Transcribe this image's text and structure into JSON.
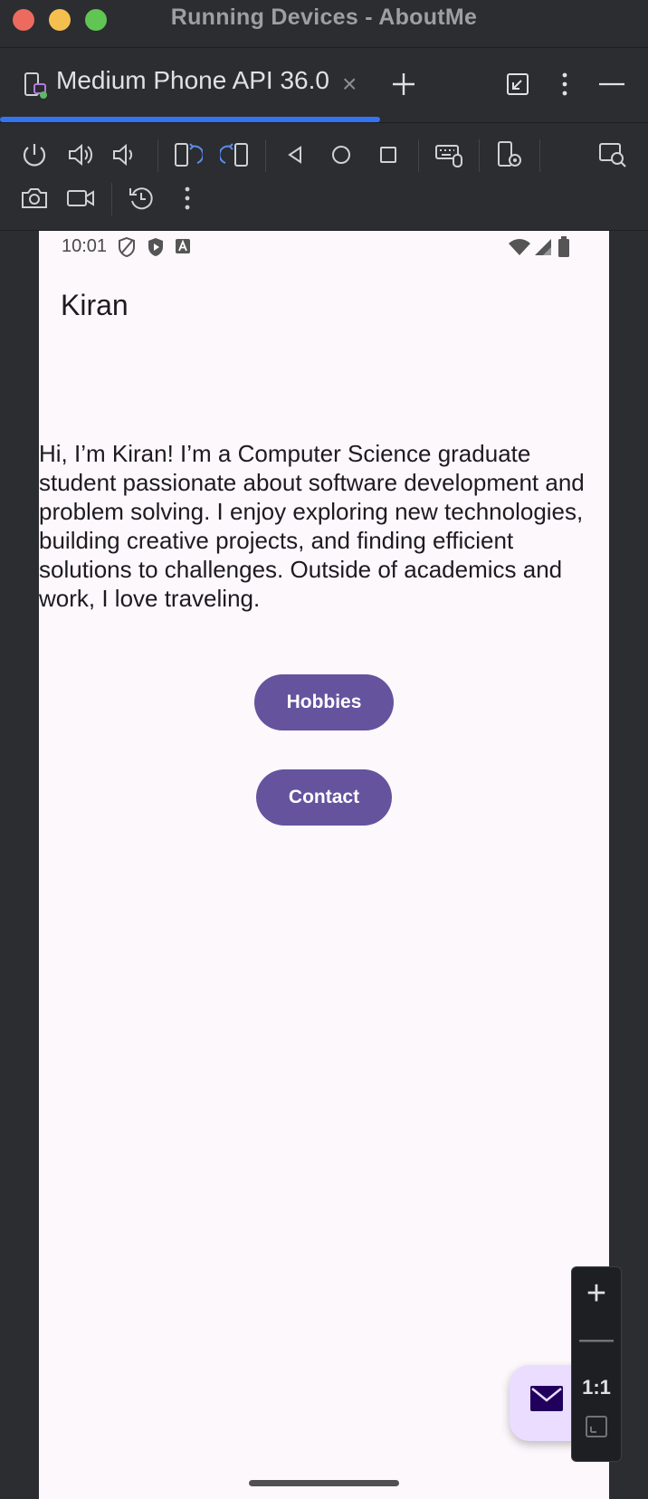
{
  "window": {
    "title": "Running Devices - AboutMe"
  },
  "tab": {
    "label": "Medium Phone API 36.0",
    "close_glyph": "×"
  },
  "toolbar": {
    "icons": [
      "power-icon",
      "volume-up-icon",
      "volume-down-icon",
      "rotate-left-icon",
      "rotate-right-icon",
      "back-icon",
      "home-icon",
      "overview-icon",
      "keyboard-mouse-icon",
      "device-settings-icon",
      "layout-inspector-icon",
      "camera-icon",
      "video-icon",
      "reset-icon",
      "more-icon"
    ]
  },
  "status_bar": {
    "time": "10:01"
  },
  "app": {
    "title": "Kiran",
    "bio": "Hi, I’m Kiran! I’m a Computer Science graduate student passionate about software development and problem solving. I enjoy exploring new technologies, building creative projects, and finding efficient solutions to challenges. Outside of academics and work, I love traveling.",
    "hobbies_button": "Hobbies",
    "contact_button": "Contact"
  },
  "zoom": {
    "plus": "+",
    "minus": "—",
    "one_to_one": "1:1"
  },
  "colors": {
    "accent": "#3574f0",
    "button": "#65539e",
    "fab": "#eaddff",
    "screen_bg": "#fdf8fc"
  }
}
